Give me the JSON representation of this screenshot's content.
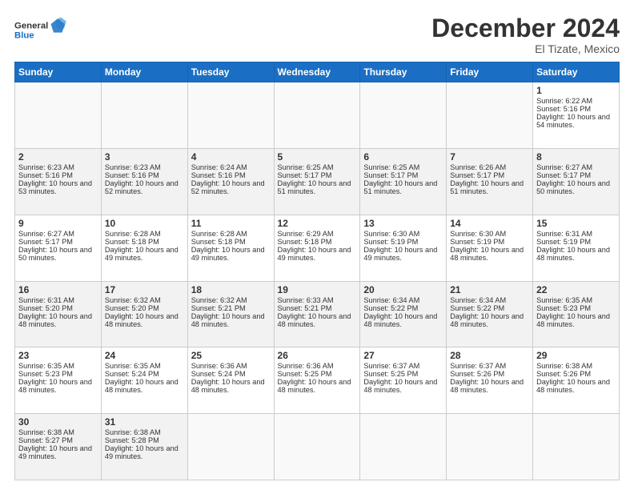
{
  "logo": {
    "line1": "General",
    "line2": "Blue"
  },
  "calendar": {
    "title": "December 2024",
    "subtitle": "El Tizate, Mexico",
    "headers": [
      "Sunday",
      "Monday",
      "Tuesday",
      "Wednesday",
      "Thursday",
      "Friday",
      "Saturday"
    ],
    "weeks": [
      [
        {
          "day": "",
          "empty": true
        },
        {
          "day": "",
          "empty": true
        },
        {
          "day": "",
          "empty": true
        },
        {
          "day": "",
          "empty": true
        },
        {
          "day": "",
          "empty": true
        },
        {
          "day": "",
          "empty": true
        },
        {
          "day": "1",
          "sunrise": "Sunrise: 6:22 AM",
          "sunset": "Sunset: 5:16 PM",
          "daylight": "Daylight: 10 hours and 54 minutes."
        }
      ],
      [
        {
          "day": "2",
          "sunrise": "Sunrise: 6:23 AM",
          "sunset": "Sunset: 5:16 PM",
          "daylight": "Daylight: 10 hours and 53 minutes."
        },
        {
          "day": "3",
          "sunrise": "Sunrise: 6:23 AM",
          "sunset": "Sunset: 5:16 PM",
          "daylight": "Daylight: 10 hours and 52 minutes."
        },
        {
          "day": "4",
          "sunrise": "Sunrise: 6:24 AM",
          "sunset": "Sunset: 5:16 PM",
          "daylight": "Daylight: 10 hours and 52 minutes."
        },
        {
          "day": "5",
          "sunrise": "Sunrise: 6:25 AM",
          "sunset": "Sunset: 5:17 PM",
          "daylight": "Daylight: 10 hours and 51 minutes."
        },
        {
          "day": "6",
          "sunrise": "Sunrise: 6:25 AM",
          "sunset": "Sunset: 5:17 PM",
          "daylight": "Daylight: 10 hours and 51 minutes."
        },
        {
          "day": "7",
          "sunrise": "Sunrise: 6:26 AM",
          "sunset": "Sunset: 5:17 PM",
          "daylight": "Daylight: 10 hours and 51 minutes."
        },
        {
          "day": "8",
          "sunrise": "Sunrise: 6:27 AM",
          "sunset": "Sunset: 5:17 PM",
          "daylight": "Daylight: 10 hours and 50 minutes."
        }
      ],
      [
        {
          "day": "9",
          "sunrise": "Sunrise: 6:27 AM",
          "sunset": "Sunset: 5:17 PM",
          "daylight": "Daylight: 10 hours and 50 minutes."
        },
        {
          "day": "10",
          "sunrise": "Sunrise: 6:28 AM",
          "sunset": "Sunset: 5:18 PM",
          "daylight": "Daylight: 10 hours and 49 minutes."
        },
        {
          "day": "11",
          "sunrise": "Sunrise: 6:28 AM",
          "sunset": "Sunset: 5:18 PM",
          "daylight": "Daylight: 10 hours and 49 minutes."
        },
        {
          "day": "12",
          "sunrise": "Sunrise: 6:29 AM",
          "sunset": "Sunset: 5:18 PM",
          "daylight": "Daylight: 10 hours and 49 minutes."
        },
        {
          "day": "13",
          "sunrise": "Sunrise: 6:30 AM",
          "sunset": "Sunset: 5:19 PM",
          "daylight": "Daylight: 10 hours and 49 minutes."
        },
        {
          "day": "14",
          "sunrise": "Sunrise: 6:30 AM",
          "sunset": "Sunset: 5:19 PM",
          "daylight": "Daylight: 10 hours and 48 minutes."
        },
        {
          "day": "15",
          "sunrise": "Sunrise: 6:31 AM",
          "sunset": "Sunset: 5:19 PM",
          "daylight": "Daylight: 10 hours and 48 minutes."
        }
      ],
      [
        {
          "day": "16",
          "sunrise": "Sunrise: 6:31 AM",
          "sunset": "Sunset: 5:20 PM",
          "daylight": "Daylight: 10 hours and 48 minutes."
        },
        {
          "day": "17",
          "sunrise": "Sunrise: 6:32 AM",
          "sunset": "Sunset: 5:20 PM",
          "daylight": "Daylight: 10 hours and 48 minutes."
        },
        {
          "day": "18",
          "sunrise": "Sunrise: 6:32 AM",
          "sunset": "Sunset: 5:21 PM",
          "daylight": "Daylight: 10 hours and 48 minutes."
        },
        {
          "day": "19",
          "sunrise": "Sunrise: 6:33 AM",
          "sunset": "Sunset: 5:21 PM",
          "daylight": "Daylight: 10 hours and 48 minutes."
        },
        {
          "day": "20",
          "sunrise": "Sunrise: 6:34 AM",
          "sunset": "Sunset: 5:22 PM",
          "daylight": "Daylight: 10 hours and 48 minutes."
        },
        {
          "day": "21",
          "sunrise": "Sunrise: 6:34 AM",
          "sunset": "Sunset: 5:22 PM",
          "daylight": "Daylight: 10 hours and 48 minutes."
        },
        {
          "day": "22",
          "sunrise": "Sunrise: 6:35 AM",
          "sunset": "Sunset: 5:23 PM",
          "daylight": "Daylight: 10 hours and 48 minutes."
        }
      ],
      [
        {
          "day": "23",
          "sunrise": "Sunrise: 6:35 AM",
          "sunset": "Sunset: 5:23 PM",
          "daylight": "Daylight: 10 hours and 48 minutes."
        },
        {
          "day": "24",
          "sunrise": "Sunrise: 6:35 AM",
          "sunset": "Sunset: 5:24 PM",
          "daylight": "Daylight: 10 hours and 48 minutes."
        },
        {
          "day": "25",
          "sunrise": "Sunrise: 6:36 AM",
          "sunset": "Sunset: 5:24 PM",
          "daylight": "Daylight: 10 hours and 48 minutes."
        },
        {
          "day": "26",
          "sunrise": "Sunrise: 6:36 AM",
          "sunset": "Sunset: 5:25 PM",
          "daylight": "Daylight: 10 hours and 48 minutes."
        },
        {
          "day": "27",
          "sunrise": "Sunrise: 6:37 AM",
          "sunset": "Sunset: 5:25 PM",
          "daylight": "Daylight: 10 hours and 48 minutes."
        },
        {
          "day": "28",
          "sunrise": "Sunrise: 6:37 AM",
          "sunset": "Sunset: 5:26 PM",
          "daylight": "Daylight: 10 hours and 48 minutes."
        },
        {
          "day": "29",
          "sunrise": "Sunrise: 6:38 AM",
          "sunset": "Sunset: 5:26 PM",
          "daylight": "Daylight: 10 hours and 48 minutes."
        }
      ],
      [
        {
          "day": "30",
          "sunrise": "Sunrise: 6:38 AM",
          "sunset": "Sunset: 5:27 PM",
          "daylight": "Daylight: 10 hours and 49 minutes."
        },
        {
          "day": "31",
          "sunrise": "Sunrise: 6:38 AM",
          "sunset": "Sunset: 5:28 PM",
          "daylight": "Daylight: 10 hours and 49 minutes."
        },
        {
          "day": "",
          "empty": true
        },
        {
          "day": "",
          "empty": true
        },
        {
          "day": "",
          "empty": true
        },
        {
          "day": "",
          "empty": true
        },
        {
          "day": "",
          "empty": true
        }
      ]
    ]
  }
}
